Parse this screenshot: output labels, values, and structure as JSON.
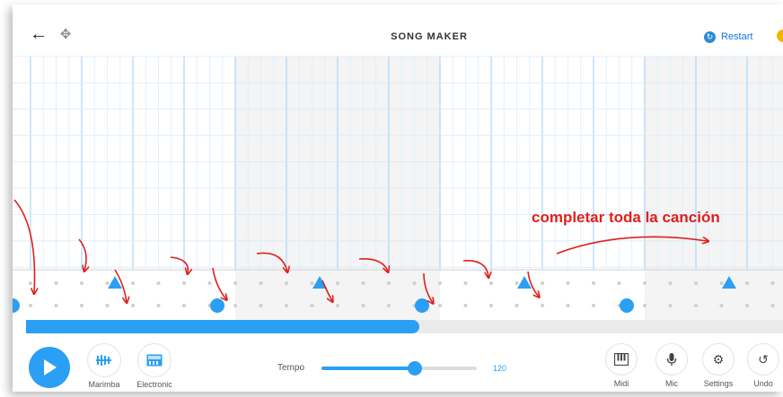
{
  "header": {
    "title": "SONG MAKER",
    "back_icon": "arrow-left-icon",
    "move_icon": "move-arrows-icon",
    "restart_label": "Restart",
    "accent": "#2b9ff3"
  },
  "grid": {
    "melody_notes": [
      {
        "shape": "circle",
        "column": 0,
        "row": 1
      },
      {
        "shape": "triangle",
        "column": 2,
        "row": 0
      },
      {
        "shape": "circle",
        "column": 4,
        "row": 1
      },
      {
        "shape": "triangle",
        "column": 6,
        "row": 0
      },
      {
        "shape": "circle",
        "column": 8,
        "row": 1
      },
      {
        "shape": "triangle",
        "column": 10,
        "row": 0
      },
      {
        "shape": "circle",
        "column": 12,
        "row": 1
      },
      {
        "shape": "triangle",
        "column": 14,
        "row": 0
      },
      {
        "shape": "circle",
        "column": 16,
        "row": 1
      }
    ],
    "note_color": "#2b9ff3",
    "annotation_text": "completar toda la canción",
    "annotation_color": "#e0201b"
  },
  "playback": {
    "progress": 0.52
  },
  "toolbar": {
    "play_icon": "play-icon",
    "instrument_1_label": "Marimba",
    "instrument_2_label": "Electronic",
    "tempo_label": "Tempo",
    "tempo_value": "120",
    "tempo_fraction": 0.6,
    "midi_label": "Midi",
    "mic_label": "Mic",
    "settings_label": "Settings",
    "undo_label": "Undo"
  }
}
